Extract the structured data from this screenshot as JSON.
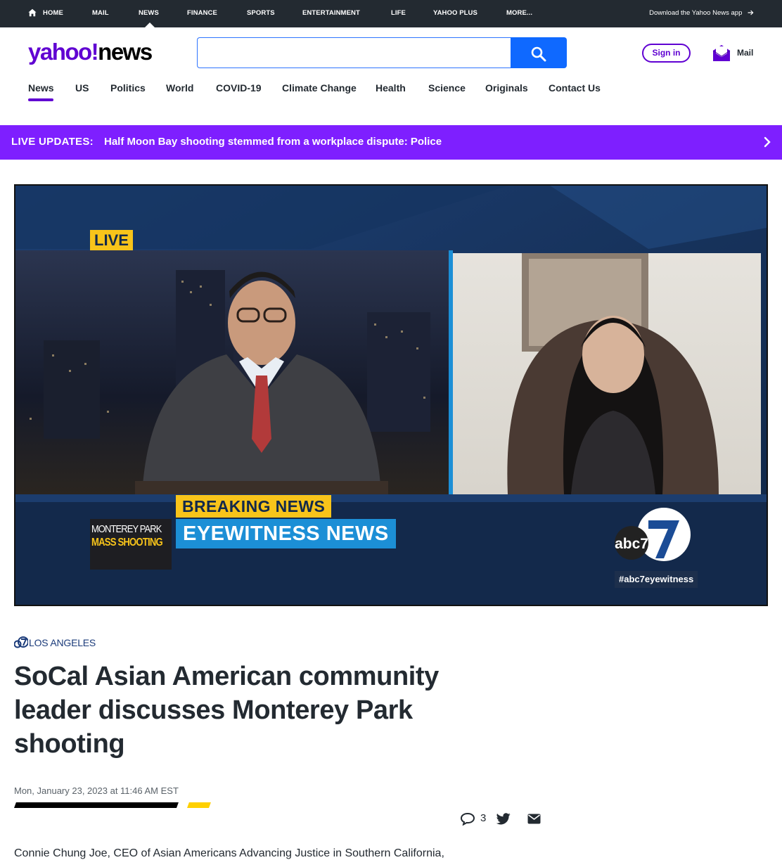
{
  "topnav": {
    "items": [
      {
        "label": "HOME"
      },
      {
        "label": "MAIL"
      },
      {
        "label": "NEWS"
      },
      {
        "label": "FINANCE"
      },
      {
        "label": "SPORTS"
      },
      {
        "label": "ENTERTAINMENT"
      },
      {
        "label": "LIFE"
      },
      {
        "label": "YAHOO PLUS"
      },
      {
        "label": "MORE..."
      }
    ],
    "active": "NEWS",
    "app_link": "Download the Yahoo News app"
  },
  "header": {
    "logo_brand": "yahoo!",
    "logo_section": "news",
    "search": {
      "value": "",
      "placeholder": ""
    },
    "signin_label": "Sign in",
    "mail_label": "Mail"
  },
  "subnav": {
    "items": [
      {
        "label": "News"
      },
      {
        "label": "US"
      },
      {
        "label": "Politics"
      },
      {
        "label": "World"
      },
      {
        "label": "COVID-19"
      },
      {
        "label": "Climate Change"
      },
      {
        "label": "Health"
      },
      {
        "label": "Science"
      },
      {
        "label": "Originals"
      },
      {
        "label": "Contact Us"
      }
    ],
    "active": "News"
  },
  "live_banner": {
    "label": "LIVE UPDATES:",
    "headline": "Half Moon Bay shooting stemmed from a workplace dispute: Police"
  },
  "video": {
    "live_tag": "LIVE",
    "breaking": "BREAKING NEWS",
    "program": "EYEWITNESS NEWS",
    "thumb_line1": "MONTEREY PARK",
    "thumb_line2": "MASS SHOOTING",
    "station": "abc7",
    "hashtag": "#abc7eyewitness"
  },
  "article": {
    "source": "LOS ANGELES",
    "headline": "SoCal Asian American community leader discusses Monterey Park shooting",
    "date": "Mon, January 23, 2023 at 11:46 AM EST",
    "comment_count": "3",
    "body_first_line": "Connie Chung Joe, CEO of Asian Americans Advancing Justice in Southern California,"
  },
  "colors": {
    "topbar_bg": "#232a31",
    "brand_purple": "#6001d2",
    "banner_purple": "#7e1fff",
    "search_blue": "#0f69ff",
    "breaking_yellow": "#f8c41a",
    "tv_blue": "#1c8fd6"
  }
}
